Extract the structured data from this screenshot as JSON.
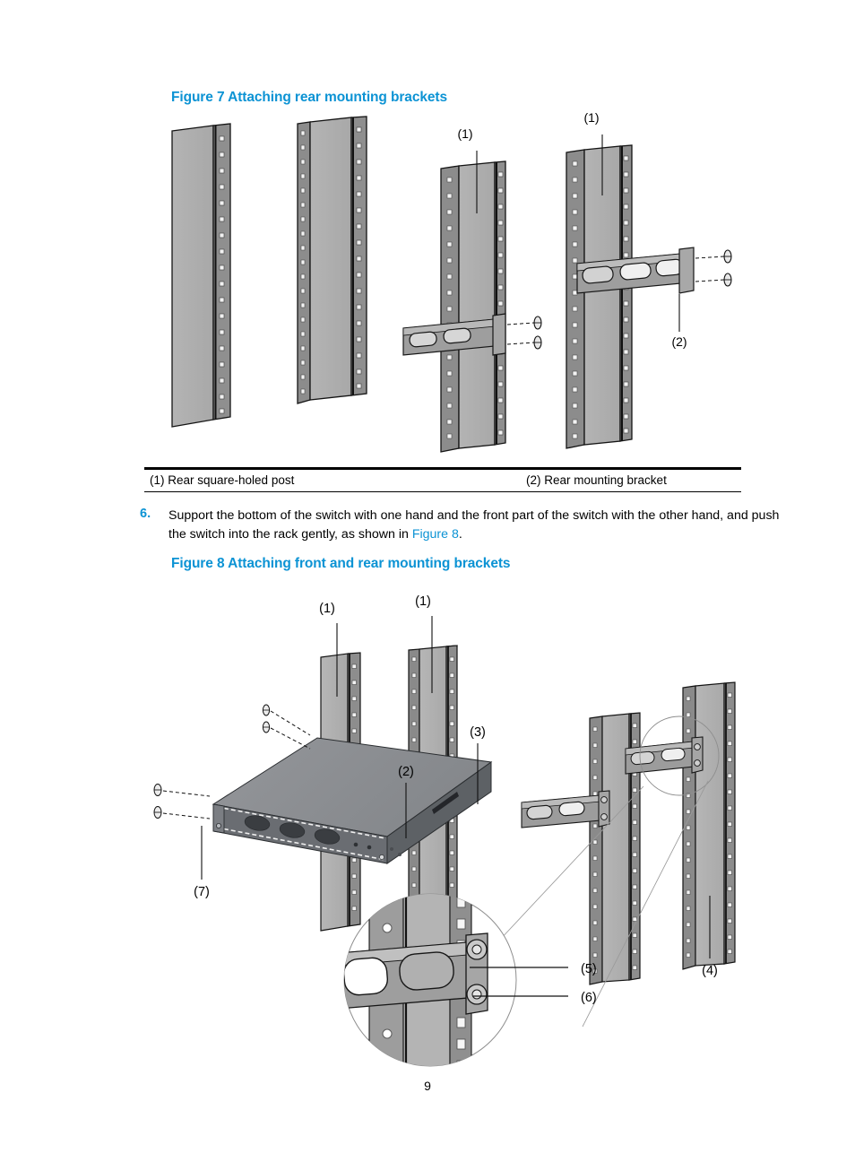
{
  "document": {
    "page_number": "9",
    "accent_color": "#0c93d4"
  },
  "figure7": {
    "caption": "Figure 7 Attaching rear mounting brackets",
    "callouts": [
      {
        "id": "c1a",
        "text": "(1)"
      },
      {
        "id": "c1b",
        "text": "(1)"
      },
      {
        "id": "c2",
        "text": "(2)"
      }
    ],
    "legend": {
      "items": [
        {
          "text": "(1) Rear square-holed post"
        },
        {
          "text": "(2) Rear mounting bracket"
        }
      ]
    }
  },
  "step6": {
    "number": "6.",
    "text_before": "Support the bottom of the switch with one hand and the front part of the switch with the other hand, and push the switch into the rack gently, as shown in ",
    "xref": "Figure 8",
    "text_after": "."
  },
  "figure8": {
    "caption": "Figure 8 Attaching front and rear mounting brackets",
    "callouts": [
      {
        "id": "f8c1a",
        "text": "(1)"
      },
      {
        "id": "f8c1b",
        "text": "(1)"
      },
      {
        "id": "f8c2",
        "text": "(2)"
      },
      {
        "id": "f8c3",
        "text": "(3)"
      },
      {
        "id": "f8c4",
        "text": "(4)"
      },
      {
        "id": "f8c5",
        "text": "(5)"
      },
      {
        "id": "f8c6",
        "text": "(6)"
      },
      {
        "id": "f8c7",
        "text": "(7)"
      }
    ]
  },
  "colors": {
    "post_face_light": "#b9b9b9",
    "post_face_mid": "#9d9d9d",
    "post_face_dark": "#8a8a8a",
    "chassis_top": "#8d8f93",
    "chassis_front": "#6e7176",
    "chassis_side": "#5c6064",
    "bracket": "#9a9a9a",
    "outline": "#1a1a1a"
  }
}
